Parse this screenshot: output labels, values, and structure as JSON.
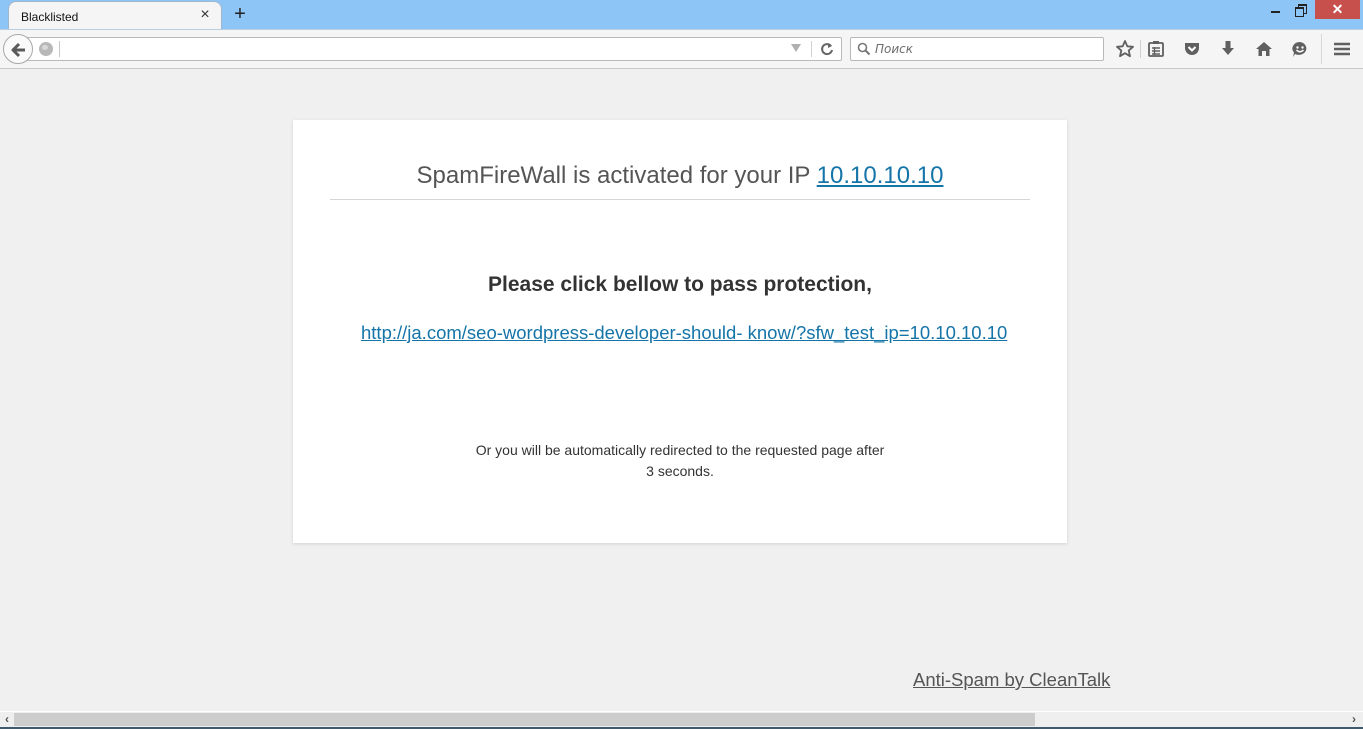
{
  "browser": {
    "tab": {
      "title": "Blacklisted",
      "close_glyph": "×"
    },
    "new_tab_glyph": "+",
    "window_controls": {
      "close_glyph": "✕"
    },
    "url": {
      "value": "",
      "dropdown_icon": "dropdown-arrow-icon"
    },
    "search": {
      "placeholder": "Поиск"
    },
    "toolbar_icons": [
      "bookmark-star-icon",
      "reading-list-icon",
      "pocket-icon",
      "download-icon",
      "home-icon",
      "chat-icon",
      "menu-icon"
    ]
  },
  "page": {
    "headline_prefix": "SpamFireWall is activated for your IP ",
    "ip": "10.10.10.10",
    "instruction": "Please click bellow to pass protection,",
    "pass_link": "http://ja.com/seo-wordpress-developer-should- know/?sfw_test_ip=10.10.10.10",
    "redirect_line1": "Or you will be automatically redirected to the requested page after",
    "redirect_line2": "3 seconds.",
    "footer_link": "Anti-Spam by CleanTalk"
  },
  "colors": {
    "link": "#1574a8",
    "titlebar": "#8ec5f7",
    "close_button": "#c7504d",
    "background": "#f0f0f0"
  },
  "scrollbar": {
    "horizontal_thumb_fraction": 0.75,
    "left_glyph": "‹",
    "right_glyph": "›"
  }
}
